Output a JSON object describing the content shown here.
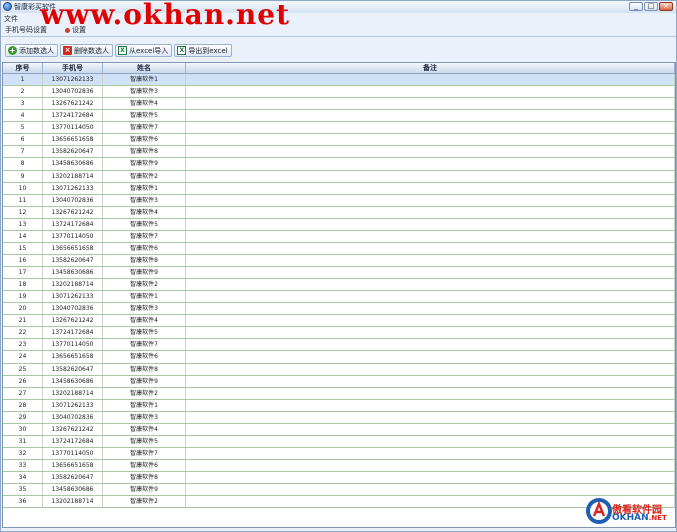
{
  "window": {
    "title": "智康彩买软件",
    "controls": [
      "_",
      "□",
      "×"
    ]
  },
  "watermark": {
    "top": "www.okhan.net",
    "bottom_cn": "傲看软件园",
    "bottom_en": "OKHAN",
    "bottom_en_suffix": ".NET"
  },
  "menu": {
    "items": [
      "文件"
    ]
  },
  "tabs": [
    {
      "label": "手机号码设置"
    },
    {
      "label": "设置"
    }
  ],
  "toolbar": {
    "add_label": "添加数选人",
    "delete_label": "删除数选人",
    "import_label": "从excel导入",
    "export_label": "导出到excel"
  },
  "table": {
    "columns": [
      "序号",
      "手机号",
      "姓名",
      "备注"
    ],
    "rows": [
      [
        "1",
        "13071262133",
        "智康软件1",
        ""
      ],
      [
        "2",
        "13040702836",
        "智康软件3",
        ""
      ],
      [
        "3",
        "13267621242",
        "智康软件4",
        ""
      ],
      [
        "4",
        "13724172684",
        "智康软件5",
        ""
      ],
      [
        "5",
        "13770114050",
        "智康软件7",
        ""
      ],
      [
        "6",
        "13656651658",
        "智康软件6",
        ""
      ],
      [
        "7",
        "13582620647",
        "智康软件8",
        ""
      ],
      [
        "8",
        "13458630686",
        "智康软件9",
        ""
      ],
      [
        "9",
        "13202188714",
        "智康软件2",
        ""
      ],
      [
        "10",
        "13071262133",
        "智康软件1",
        ""
      ],
      [
        "11",
        "13040702836",
        "智康软件3",
        ""
      ],
      [
        "12",
        "13267621242",
        "智康软件4",
        ""
      ],
      [
        "13",
        "13724172684",
        "智康软件5",
        ""
      ],
      [
        "14",
        "13770114050",
        "智康软件7",
        ""
      ],
      [
        "15",
        "13656651658",
        "智康软件6",
        ""
      ],
      [
        "16",
        "13582620647",
        "智康软件8",
        ""
      ],
      [
        "17",
        "13458630686",
        "智康软件9",
        ""
      ],
      [
        "18",
        "13202188714",
        "智康软件2",
        ""
      ],
      [
        "19",
        "13071262133",
        "智康软件1",
        ""
      ],
      [
        "20",
        "13040702836",
        "智康软件3",
        ""
      ],
      [
        "21",
        "13267621242",
        "智康软件4",
        ""
      ],
      [
        "22",
        "13724172684",
        "智康软件5",
        ""
      ],
      [
        "23",
        "13770114050",
        "智康软件7",
        ""
      ],
      [
        "24",
        "13656651658",
        "智康软件6",
        ""
      ],
      [
        "25",
        "13582620647",
        "智康软件8",
        ""
      ],
      [
        "26",
        "13458630686",
        "智康软件9",
        ""
      ],
      [
        "27",
        "13202188714",
        "智康软件2",
        ""
      ],
      [
        "28",
        "13071262133",
        "智康软件1",
        ""
      ],
      [
        "29",
        "13040702836",
        "智康软件3",
        ""
      ],
      [
        "30",
        "13267621242",
        "智康软件4",
        ""
      ],
      [
        "31",
        "13724172684",
        "智康软件5",
        ""
      ],
      [
        "32",
        "13770114050",
        "智康软件7",
        ""
      ],
      [
        "33",
        "13656651658",
        "智康软件6",
        ""
      ],
      [
        "34",
        "13582620647",
        "智康软件8",
        ""
      ],
      [
        "35",
        "13458630686",
        "智康软件9",
        ""
      ],
      [
        "36",
        "13202188714",
        "智康软件2",
        ""
      ]
    ],
    "selected_row": 0
  },
  "colors": {
    "selected_row": "#cfe2f8",
    "row_border": "#a9c9a2",
    "watermark_red": "#e10000",
    "brand_blue": "#1e5fb2"
  }
}
